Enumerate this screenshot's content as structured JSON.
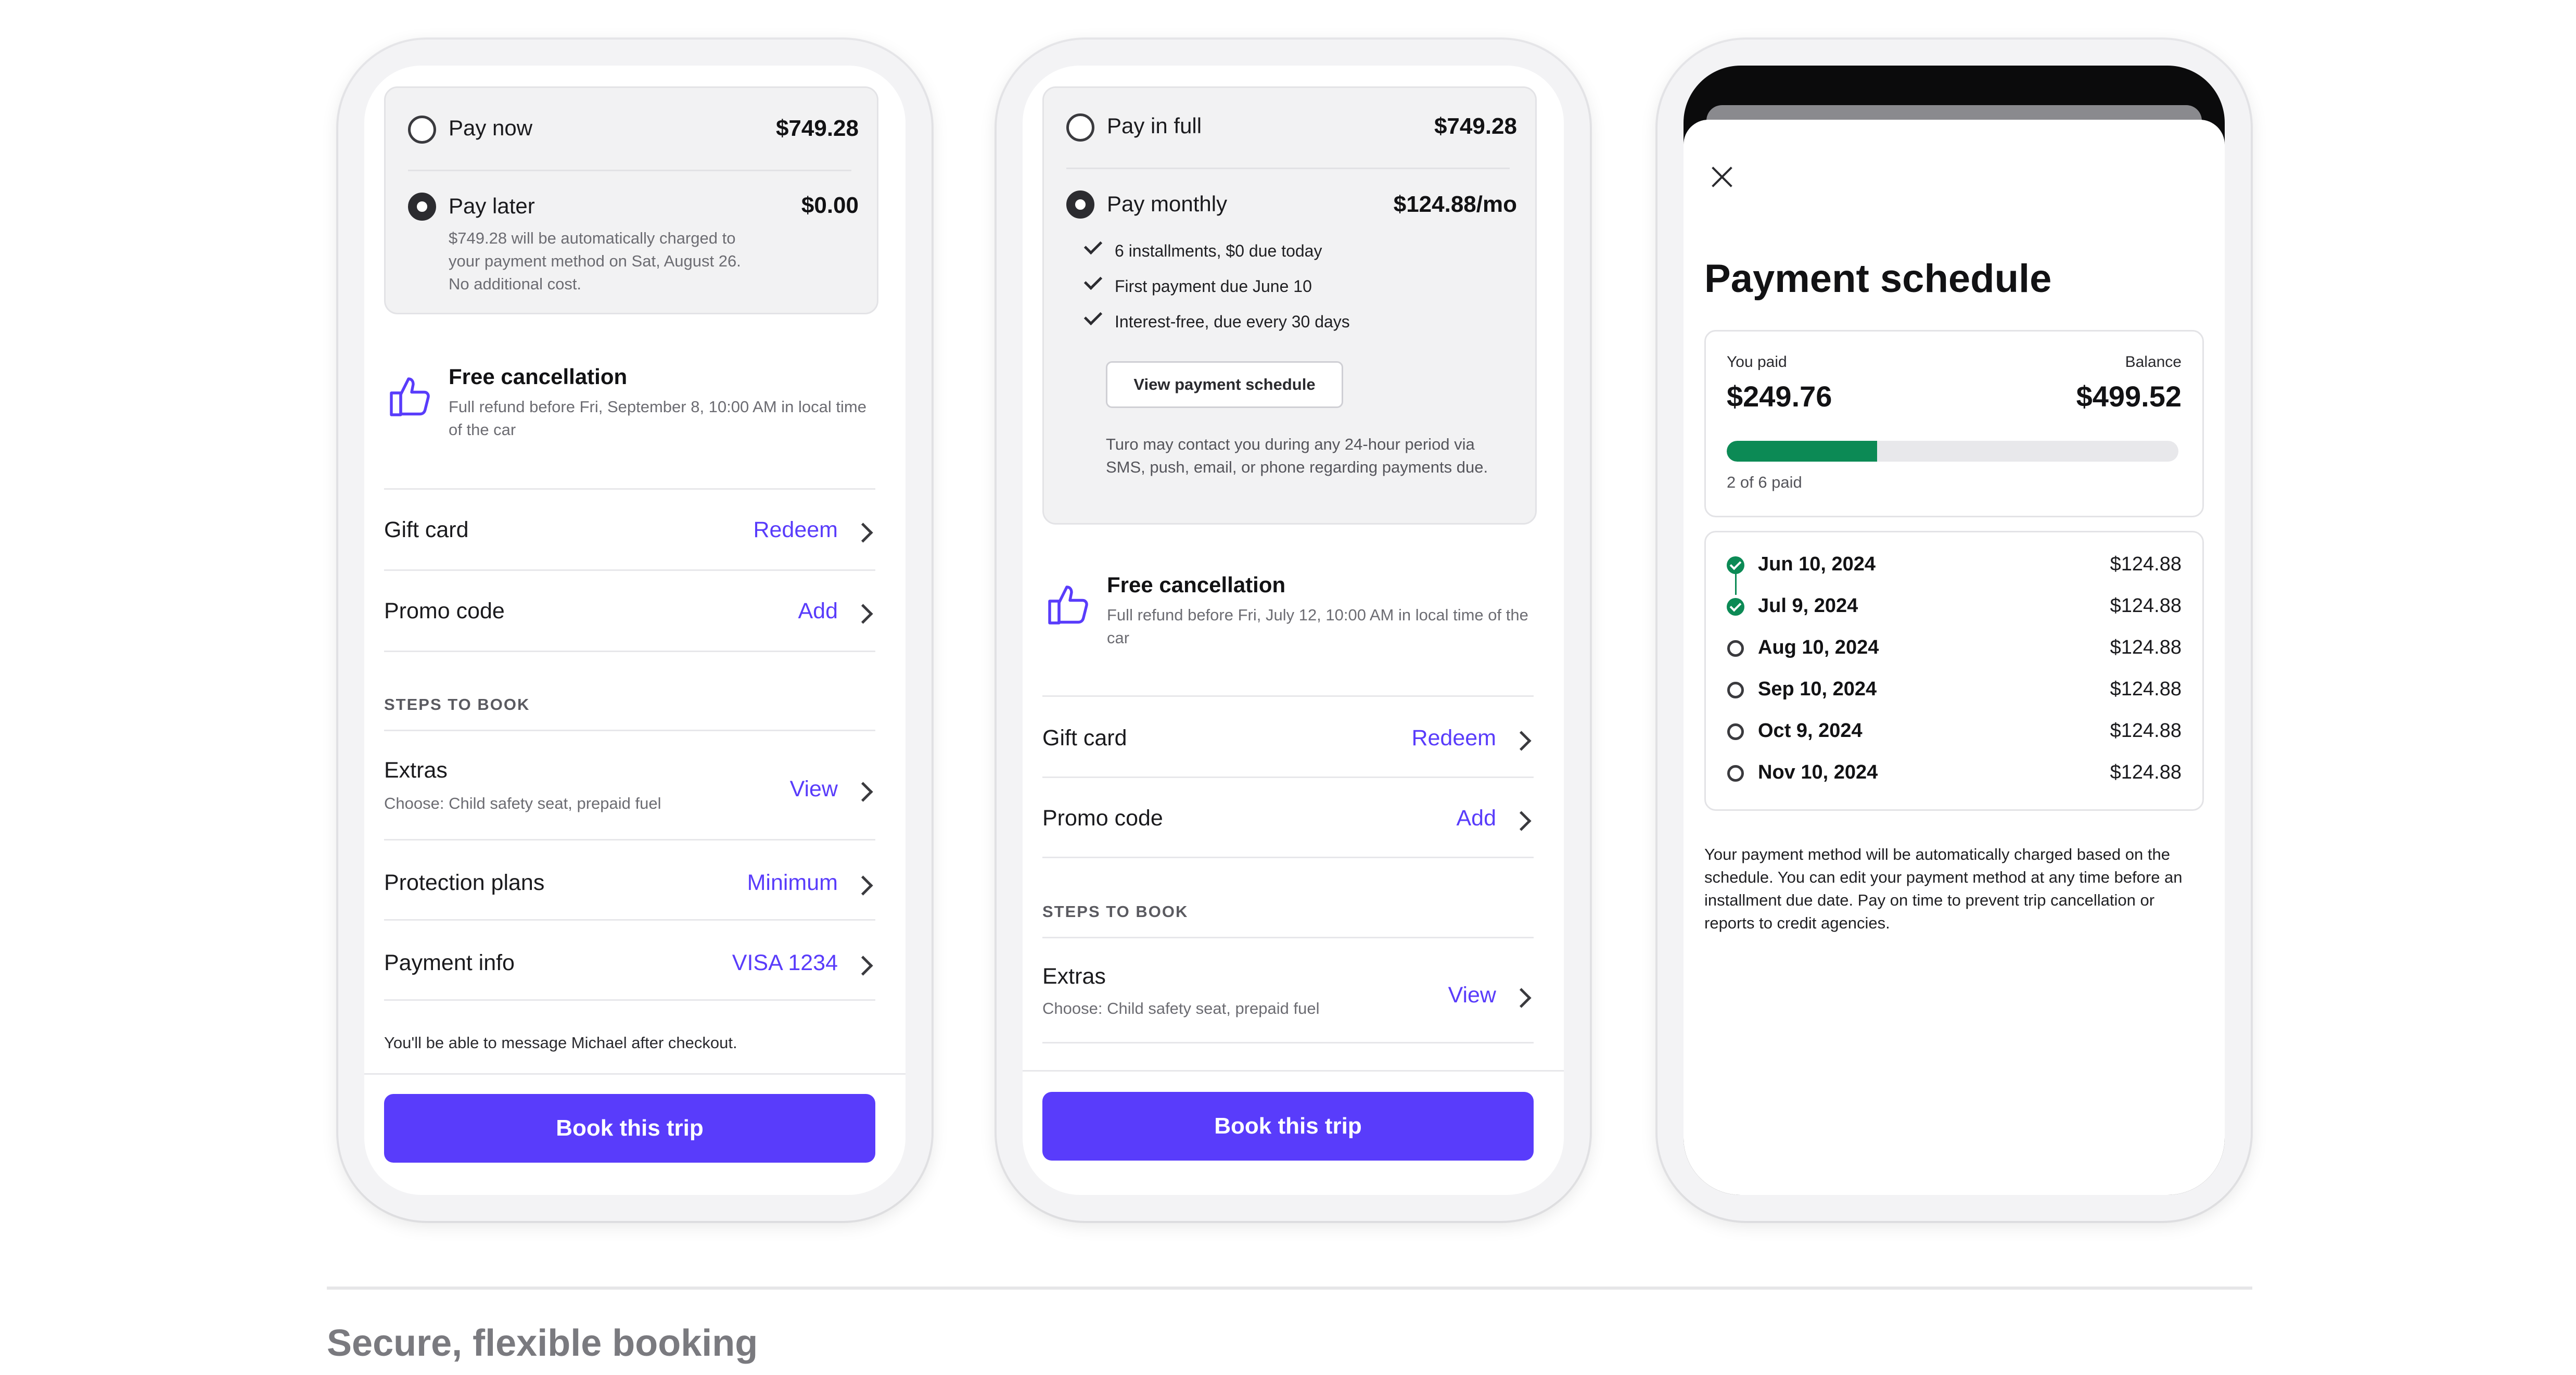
{
  "phone1": {
    "pay_now_label": "Pay now",
    "pay_now_price": "$749.28",
    "pay_later_label": "Pay later",
    "pay_later_price": "$0.00",
    "pay_later_note": "$749.28 will be automatically charged to your payment method on Sat, August 26. No additional cost.",
    "free_cancel_title": "Free cancellation",
    "free_cancel_text": "Full refund before Fri, September 8, 10:00 AM in local time of the car",
    "gift_card_label": "Gift card",
    "gift_card_action": "Redeem",
    "promo_label": "Promo code",
    "promo_action": "Add",
    "steps_title": "STEPS TO BOOK",
    "extras_label": "Extras",
    "extras_sub": "Choose: Child safety seat, prepaid fuel",
    "extras_action": "View",
    "protection_label": "Protection plans",
    "protection_action": "Minimum",
    "payment_label": "Payment info",
    "payment_action": "VISA 1234",
    "message_note": "You'll be able to message Michael after checkout.",
    "cta": "Book this trip"
  },
  "phone2": {
    "pay_full_label": "Pay in full",
    "pay_full_price": "$749.28",
    "pay_monthly_label": "Pay monthly",
    "pay_monthly_price": "$124.88/mo",
    "checks": [
      "6 installments, $0 due today",
      "First payment due June 10",
      "Interest-free, due every 30 days"
    ],
    "view_schedule_button": "View payment schedule",
    "contact_note": "Turo may contact you during any 24-hour period via SMS, push, email, or phone regarding payments due.",
    "free_cancel_title": "Free cancellation",
    "free_cancel_text": "Full refund before Fri, July 12, 10:00 AM in local time of the car",
    "gift_card_label": "Gift card",
    "gift_card_action": "Redeem",
    "promo_label": "Promo code",
    "promo_action": "Add",
    "steps_title": "STEPS TO BOOK",
    "extras_label": "Extras",
    "extras_sub": "Choose: Child safety seat, prepaid fuel",
    "extras_action": "View",
    "cta": "Book this trip"
  },
  "phone3": {
    "title": "Payment schedule",
    "you_paid_label": "You paid",
    "you_paid_value": "$249.76",
    "balance_label": "Balance",
    "balance_value": "$499.52",
    "progress_fraction": 0.333,
    "progress_text": "2 of 6 paid",
    "schedule": [
      {
        "date": "Jun 10, 2024",
        "amount": "$124.88",
        "paid": true
      },
      {
        "date": "Jul 9, 2024",
        "amount": "$124.88",
        "paid": true
      },
      {
        "date": "Aug 10, 2024",
        "amount": "$124.88",
        "paid": false
      },
      {
        "date": "Sep 10, 2024",
        "amount": "$124.88",
        "paid": false
      },
      {
        "date": "Oct 9, 2024",
        "amount": "$124.88",
        "paid": false
      },
      {
        "date": "Nov 10, 2024",
        "amount": "$124.88",
        "paid": false
      }
    ],
    "footer_note": "Your payment method will be automatically charged based on the schedule. You can edit your payment method at any time before an installment due date. Pay on time to prevent trip cancellation or reports to credit agencies."
  },
  "caption": "Secure, flexible booking",
  "colors": {
    "accent": "#593cfb",
    "success": "#0c8a55",
    "panel_bg": "#f2f2f3"
  }
}
